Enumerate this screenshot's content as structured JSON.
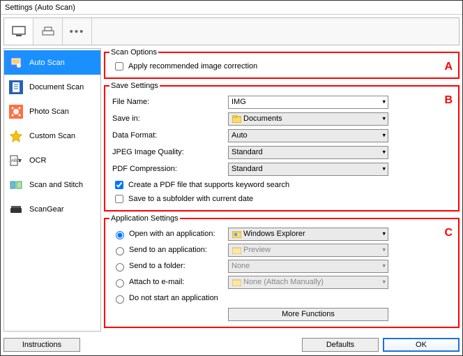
{
  "window": {
    "title": "Settings (Auto Scan)"
  },
  "sidebar": {
    "items": [
      {
        "label": "Auto Scan"
      },
      {
        "label": "Document Scan"
      },
      {
        "label": "Photo Scan"
      },
      {
        "label": "Custom Scan"
      },
      {
        "label": "OCR"
      },
      {
        "label": "Scan and Stitch"
      },
      {
        "label": "ScanGear"
      }
    ]
  },
  "letters": {
    "a": "A",
    "b": "B",
    "c": "C"
  },
  "scan_options": {
    "legend": "Scan Options",
    "apply_correction": "Apply recommended image correction"
  },
  "save": {
    "legend": "Save Settings",
    "file_name_label": "File Name:",
    "file_name_value": "IMG",
    "save_in_label": "Save in:",
    "save_in_value": "Documents",
    "data_format_label": "Data Format:",
    "data_format_value": "Auto",
    "jpeg_label": "JPEG Image Quality:",
    "jpeg_value": "Standard",
    "pdf_label": "PDF Compression:",
    "pdf_value": "Standard",
    "pdf_keyword": "Create a PDF file that supports keyword search",
    "subfolder": "Save to a subfolder with current date"
  },
  "app": {
    "legend": "Application Settings",
    "open_label": "Open with an application:",
    "open_value": "Windows Explorer",
    "send_app_label": "Send to an application:",
    "send_app_value": "Preview",
    "send_folder_label": "Send to a folder:",
    "send_folder_value": "None",
    "attach_label": "Attach to e-mail:",
    "attach_value": "None (Attach Manually)",
    "nostart_label": "Do not start an application",
    "more_functions": "More Functions"
  },
  "buttons": {
    "instructions": "Instructions",
    "defaults": "Defaults",
    "ok": "OK"
  }
}
